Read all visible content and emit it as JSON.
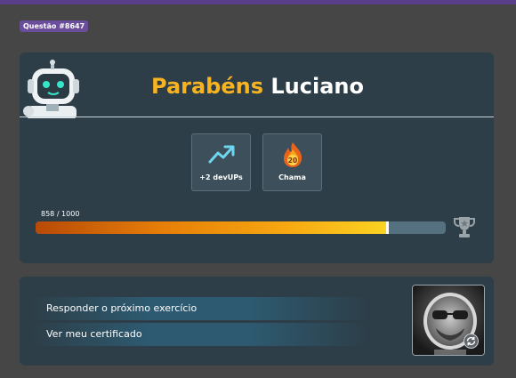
{
  "question": {
    "badge": "Questão #8647"
  },
  "result": {
    "greeting": "Parabéns",
    "user_name": "Luciano",
    "rewards": [
      {
        "icon": "trending-up-icon",
        "label": "+2 devUPs"
      },
      {
        "icon": "flame-icon",
        "label": "Chama",
        "badge_value": "20"
      }
    ],
    "xp": {
      "label": "858 / 1000",
      "current": 858,
      "max": 1000
    },
    "trophy_icon": "trophy-icon"
  },
  "actions": {
    "next_exercise": "Responder o próximo exercício",
    "certificate": "Ver meu certificado"
  },
  "avatar": {
    "icon": "refresh-icon"
  },
  "colors": {
    "accent": "#f7b320",
    "card_bg": "#2d3e48",
    "page_bg": "#464646",
    "badge_bg": "#6b4e9b"
  }
}
